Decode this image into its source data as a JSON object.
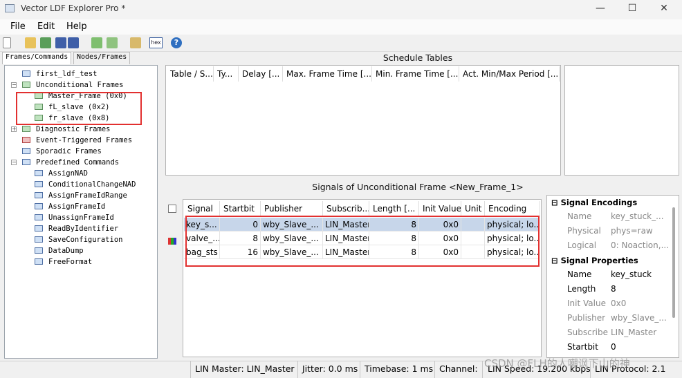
{
  "window": {
    "title": "Vector LDF Explorer Pro *",
    "minimize": "—",
    "maximize": "☐",
    "close": "✕"
  },
  "menu": [
    "File",
    "Edit",
    "Help"
  ],
  "toolbar": {
    "hex_label": "hex"
  },
  "tabs": [
    "Frames/Commands",
    "Nodes/Frames"
  ],
  "tree": {
    "root": "first_ldf_test",
    "unconditional": "Unconditional Frames",
    "unconditional_items": [
      "Master_Frame (0x0)",
      "fL_slave (0x2)",
      "fr_slave (0x8)"
    ],
    "diagnostic": "Diagnostic Frames",
    "event": "Event-Triggered Frames",
    "sporadic": "Sporadic Frames",
    "predefined": "Predefined Commands",
    "predefined_items": [
      "AssignNAD",
      "ConditionalChangeNAD",
      "AssignFrameIdRange",
      "AssignFrameId",
      "UnassignFrameId",
      "ReadByIdentifier",
      "SaveConfiguration",
      "DataDump",
      "FreeFormat"
    ]
  },
  "schedule": {
    "title": "Schedule Tables",
    "columns": [
      "Table / S...",
      "Ty...",
      "Delay [...",
      "Max. Frame Time [...",
      "Min. Frame Time [...",
      "Act. Min/Max Period [..."
    ]
  },
  "signals": {
    "title": "Signals of Unconditional Frame <New_Frame_1>",
    "columns": [
      "Signal",
      "Startbit",
      "Publisher",
      "Subscrib...",
      "Length [...",
      "Init Value",
      "Unit",
      "Encoding"
    ],
    "rows": [
      [
        "key_s...",
        "0",
        "wby_Slave_...",
        "LIN_Master",
        "8",
        "0x0",
        "",
        "physical; lo..."
      ],
      [
        "valve_...",
        "8",
        "wby_Slave_...",
        "LIN_Master",
        "8",
        "0x0",
        "",
        "physical; lo..."
      ],
      [
        "bag_sts",
        "16",
        "wby_Slave_...",
        "LIN_Master",
        "8",
        "0x0",
        "",
        "physical; lo..."
      ]
    ]
  },
  "properties": {
    "encodings_title": "Signal Encodings",
    "encodings": [
      [
        "Name",
        "key_stuck_..."
      ],
      [
        "Physical",
        "phys=raw"
      ],
      [
        "Logical",
        "0: Noaction,..."
      ]
    ],
    "props_title": "Signal Properties",
    "props": [
      [
        "Name",
        "key_stuck"
      ],
      [
        "Length",
        "8"
      ],
      [
        "Init Value",
        "0x0"
      ],
      [
        "Publisher",
        "wby_Slave_..."
      ],
      [
        "Subscribers",
        "LIN_Master"
      ],
      [
        "Startbit",
        "0"
      ]
    ]
  },
  "status": {
    "master": "LIN Master: LIN_Master",
    "jitter": "Jitter: 0.0 ms",
    "timebase": "Timebase: 1 ms",
    "channel": "Channel:",
    "speed": "LIN Speed: 19.200 kbps",
    "protocol": "LIN Protocol: 2.1"
  },
  "watermark": "CSDN @FLH的人嘲讽下山的神"
}
